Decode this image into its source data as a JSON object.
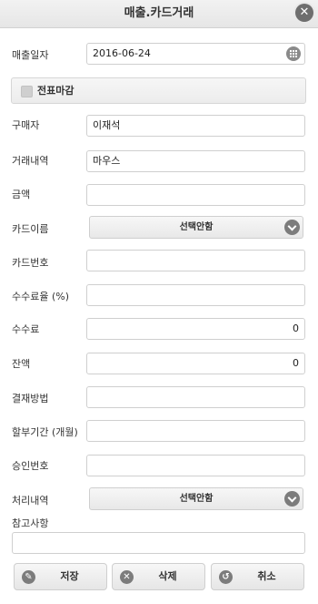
{
  "header": {
    "title": "매출.카드거래",
    "close_icon": "close-icon"
  },
  "form": {
    "sale_date": {
      "label": "매출일자",
      "value": "2016-06-24"
    },
    "slip_close": {
      "label": "전표마감",
      "checked": false
    },
    "buyer": {
      "label": "구매자",
      "value": "이재석"
    },
    "transaction_detail": {
      "label": "거래내역",
      "value": "마우스"
    },
    "amount": {
      "label": "금액",
      "value": ""
    },
    "card_name": {
      "label": "카드이름",
      "selected": "선택안함"
    },
    "card_number": {
      "label": "카드번호",
      "value": ""
    },
    "fee_rate": {
      "label": "수수료율 (%)",
      "value": ""
    },
    "fee": {
      "label": "수수료",
      "value": "0"
    },
    "balance": {
      "label": "잔액",
      "value": "0"
    },
    "payment_method": {
      "label": "결재방법",
      "value": ""
    },
    "installment": {
      "label": "할부기간 (개월)",
      "value": ""
    },
    "approval_number": {
      "label": "승인번호",
      "value": ""
    },
    "processing_detail": {
      "label": "처리내역",
      "selected": "선택안함"
    },
    "memo": {
      "label": "참고사항",
      "value": ""
    }
  },
  "buttons": {
    "save": {
      "label": "저장",
      "icon": "pencil-icon"
    },
    "delete": {
      "label": "삭제",
      "icon": "delete-icon"
    },
    "cancel": {
      "label": "취소",
      "icon": "undo-icon"
    }
  }
}
